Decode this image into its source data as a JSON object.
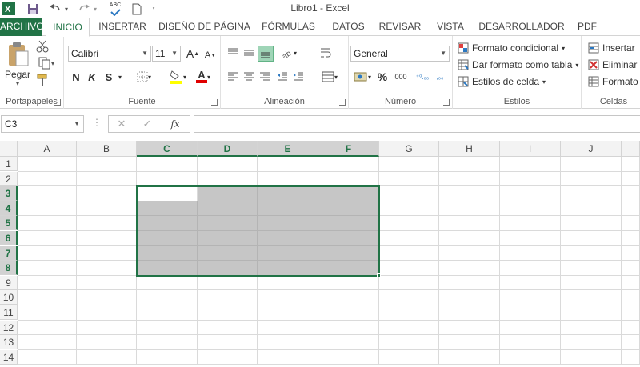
{
  "window": {
    "title": "Libro1 - Excel"
  },
  "quick_access": [
    {
      "name": "excel-logo-icon"
    },
    {
      "name": "save-icon"
    },
    {
      "name": "undo-icon"
    },
    {
      "name": "redo-icon"
    },
    {
      "name": "spelling-icon",
      "label": "ABC"
    },
    {
      "name": "new-document-icon"
    },
    {
      "name": "customize-qat-icon"
    }
  ],
  "tabs": [
    "ARCHIVO",
    "INICIO",
    "INSERTAR",
    "DISEÑO DE PÁGINA",
    "FÓRMULAS",
    "DATOS",
    "REVISAR",
    "VISTA",
    "DESARROLLADOR",
    "PDF"
  ],
  "active_tab": "INICIO",
  "ribbon": {
    "clipboard": {
      "label": "Portapapeles",
      "paste": "Pegar"
    },
    "font": {
      "label": "Fuente",
      "family": "Calibri",
      "size": "11",
      "grow": "A",
      "shrink": "A",
      "bold": "N",
      "italic": "K",
      "underline": "S",
      "font_color": "A"
    },
    "alignment": {
      "label": "Alineación"
    },
    "number": {
      "label": "Número",
      "format": "General",
      "percent": "%",
      "thousands": "000",
      "inc_decimal": "⁺⁰.₀₀",
      "dec_decimal": ",₀₀"
    },
    "styles": {
      "label": "Estilos",
      "conditional": "Formato condicional",
      "as_table": "Dar formato como tabla",
      "cell_styles": "Estilos de celda"
    },
    "cells": {
      "label": "Celdas",
      "insert": "Insertar",
      "delete": "Eliminar",
      "format": "Formato"
    }
  },
  "formula_bar": {
    "name_box": "C3",
    "fx": "fx",
    "cancel": "✕",
    "enter": "✓",
    "dots": "⋮",
    "value": ""
  },
  "sheet": {
    "columns": [
      "A",
      "B",
      "C",
      "D",
      "E",
      "F",
      "G",
      "H",
      "I",
      "J"
    ],
    "selected_columns": [
      "C",
      "D",
      "E",
      "F"
    ],
    "rows": [
      "1",
      "2",
      "3",
      "4",
      "5",
      "6",
      "7",
      "8",
      "9",
      "10",
      "11",
      "12",
      "13",
      "14"
    ],
    "selected_rows": [
      "3",
      "4",
      "5",
      "6",
      "7",
      "8"
    ],
    "active_cell": "C3",
    "selection": "C3:F8",
    "colors": {
      "accent": "#217346",
      "selection_fill": "#c6c6c6"
    }
  }
}
